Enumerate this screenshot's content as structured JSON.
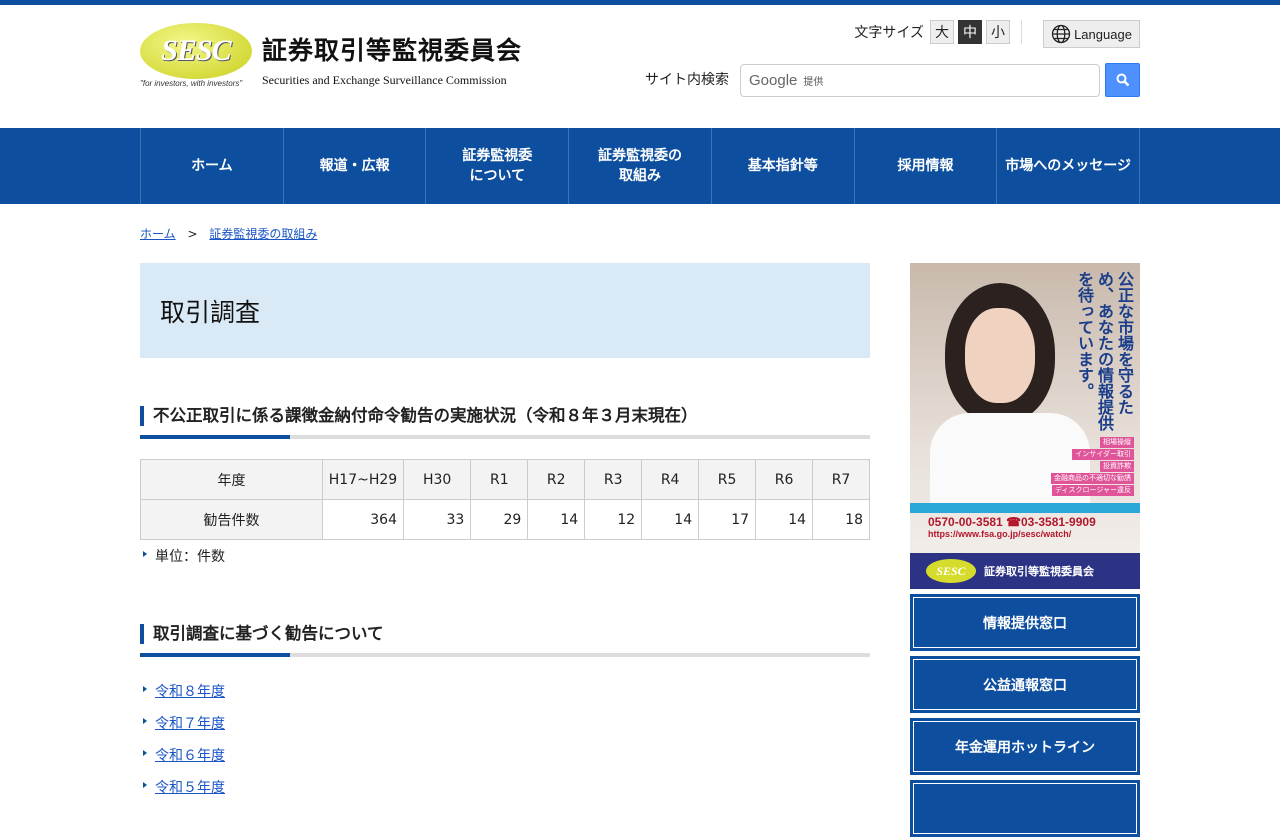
{
  "header": {
    "logo_mark": "SESC",
    "logo_tagline": "\"for investors, with investors\"",
    "site_title": "証券取引等監視委員会",
    "site_title_en": "Securities and Exchange Surveillance Commission",
    "font_size_label": "文字サイズ",
    "font_sizes": [
      "大",
      "中",
      "小"
    ],
    "language_label": "Language",
    "search_label": "サイト内検索",
    "search_placeholder": "Google",
    "search_provided": "提供"
  },
  "nav": [
    "ホーム",
    "報道・広報",
    "証券監視委\nについて",
    "証券監視委の\n取組み",
    "基本指針等",
    "採用情報",
    "市場へのメッセージ"
  ],
  "breadcrumb": {
    "home": "ホーム",
    "sep": ">",
    "current": "証券監視委の取組み"
  },
  "main": {
    "title": "取引調査",
    "section1": "不公正取引に係る課徴金納付命令勧告の実施状況（令和８年３月末現在）",
    "table": {
      "headers": [
        "年度",
        "H17~H29",
        "H30",
        "R1",
        "R2",
        "R3",
        "R4",
        "R5",
        "R6",
        "R7"
      ],
      "row_label": "勧告件数",
      "values": [
        "364",
        "33",
        "29",
        "14",
        "12",
        "14",
        "17",
        "14",
        "18"
      ]
    },
    "unit_note": "単位：件数",
    "section2": "取引調査に基づく勧告について",
    "links": [
      "令和８年度",
      "令和７年度",
      "令和６年度",
      "令和５年度"
    ]
  },
  "sidebar": {
    "banner": {
      "headline": "公正な市場を守るため、あなたの情報提供を待っています。",
      "tags": [
        "相場操縦",
        "インサイダー取引",
        "投資詐欺",
        "金融商品の不適切な勧誘",
        "ディスクロージャー違反"
      ],
      "phone": "0570-00-3581 ☎03-3581-9909",
      "url": "https://www.fsa.go.jp/sesc/watch/",
      "org": "証券取引等監視委員会"
    },
    "buttons": [
      "情報提供窓口",
      "公益通報窓口",
      "年金運用ホットライン",
      ""
    ]
  }
}
